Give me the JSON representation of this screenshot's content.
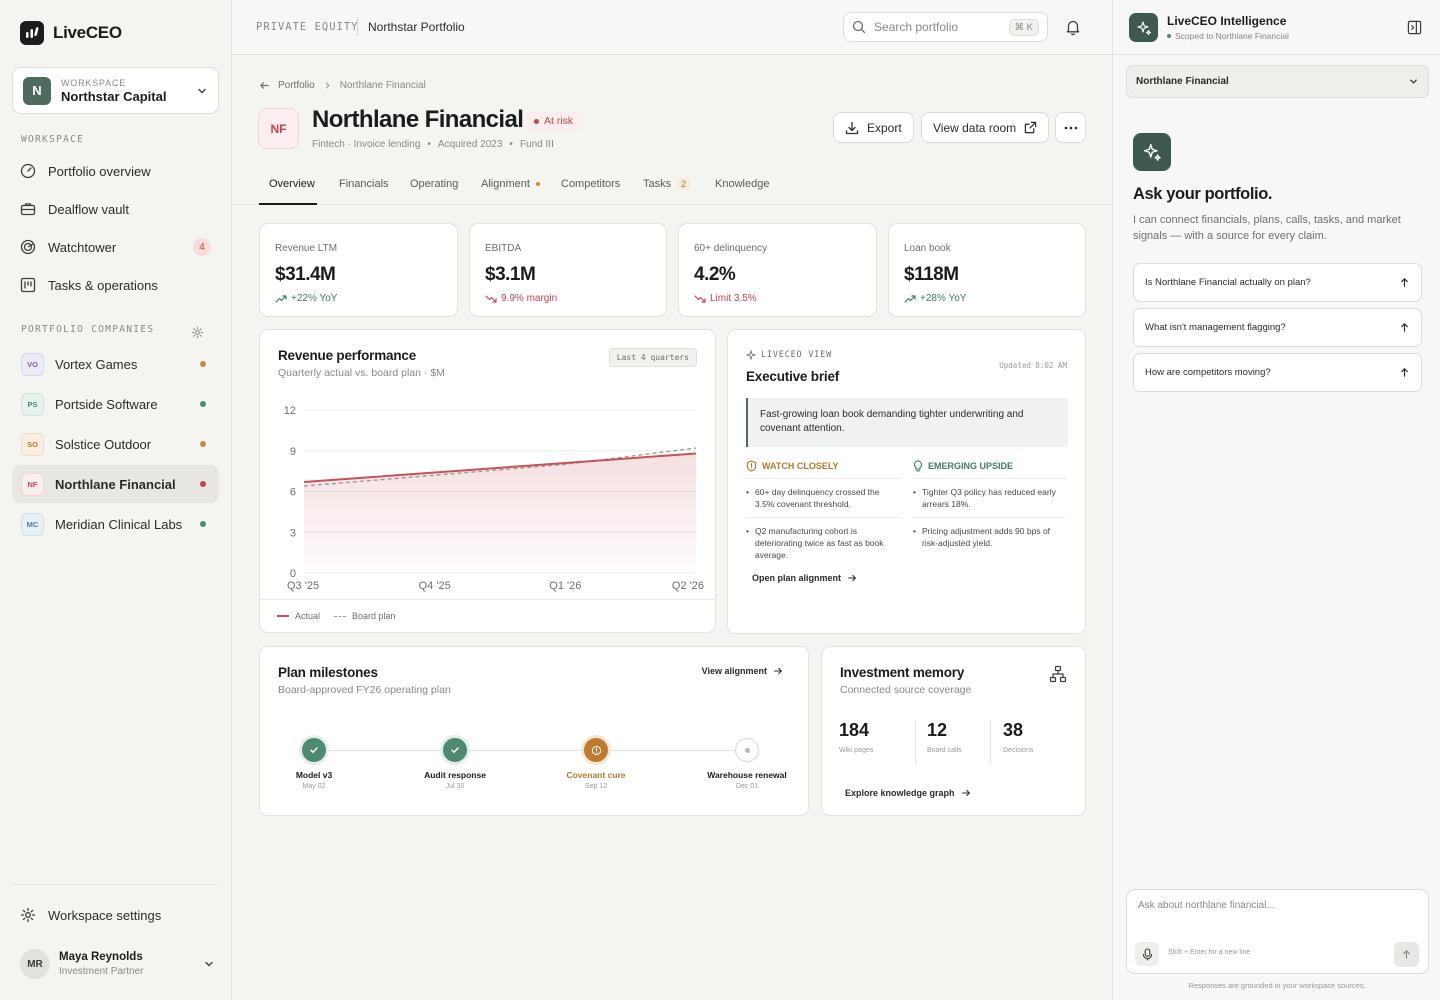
{
  "brand": {
    "name": "LiveCEO"
  },
  "workspace": {
    "label": "WORKSPACE",
    "name": "Northstar Capital",
    "initial": "N"
  },
  "nav": {
    "section_label": "WORKSPACE",
    "items": [
      {
        "label": "Portfolio overview",
        "icon": "gauge-icon"
      },
      {
        "label": "Dealflow vault",
        "icon": "briefcase-icon"
      },
      {
        "label": "Watchtower",
        "icon": "radar-icon",
        "badge": "4"
      },
      {
        "label": "Tasks & operations",
        "icon": "kanban-icon"
      }
    ]
  },
  "companies": {
    "section_label": "PORTFOLIO COMPANIES",
    "items": [
      {
        "initials": "VO",
        "name": "Vortex Games",
        "status_color": "#c98a3c"
      },
      {
        "initials": "PS",
        "name": "Portside Software",
        "status_color": "#4a8a6e"
      },
      {
        "initials": "SO",
        "name": "Solstice Outdoor",
        "status_color": "#c98a3c"
      },
      {
        "initials": "NF",
        "name": "Northlane Financial",
        "status_color": "#c0484f"
      },
      {
        "initials": "MC",
        "name": "Meridian Clinical Labs",
        "status_color": "#4a8a6e"
      }
    ]
  },
  "settings": {
    "label": "Workspace settings"
  },
  "user": {
    "initials": "MR",
    "name": "Maya Reynolds",
    "role": "Investment Partner"
  },
  "topbar": {
    "section": "PRIVATE EQUITY",
    "portfolio": "Northstar Portfolio",
    "search_placeholder": "Search portfolio",
    "shortcut": "⌘ K"
  },
  "company": {
    "breadcrumb_parent": "Portfolio",
    "breadcrumb_current": "Northlane Financial",
    "initials": "NF",
    "name": "Northlane Financial",
    "status": "At risk",
    "meta": [
      "Fintech · Invoice lending",
      "Acquired 2023",
      "Fund III"
    ],
    "export_label": "Export",
    "dataroom_label": "View data room"
  },
  "tabs": [
    {
      "label": "Overview"
    },
    {
      "label": "Financials"
    },
    {
      "label": "Operating"
    },
    {
      "label": "Alignment"
    },
    {
      "label": "Competitors"
    },
    {
      "label": "Tasks",
      "count": "2"
    },
    {
      "label": "Knowledge"
    }
  ],
  "kpis": [
    {
      "label": "Revenue LTM",
      "value": "$31.4M",
      "delta": "+22% YoY",
      "trend": "up"
    },
    {
      "label": "EBITDA",
      "value": "$3.1M",
      "delta": "9.9% margin",
      "trend": "down"
    },
    {
      "label": "60+ delinquency",
      "value": "4.2%",
      "delta": "Limit 3.5%",
      "trend": "down"
    },
    {
      "label": "Loan book",
      "value": "$118M",
      "delta": "+28% YoY",
      "trend": "up"
    }
  ],
  "revenue": {
    "title": "Revenue performance",
    "subtitle": "Quarterly actual vs. board plan · $M",
    "range": "Last 4 quarters",
    "legend_actual": "Actual",
    "legend_plan": "Board plan"
  },
  "chart_data": {
    "type": "area",
    "categories": [
      "Q3 '25",
      "Q4 '25",
      "Q1 '26",
      "Q2 '26"
    ],
    "series": [
      {
        "name": "Actual",
        "values": [
          6.7,
          7.4,
          8.1,
          8.8
        ]
      },
      {
        "name": "Board plan",
        "values": [
          6.4,
          7.2,
          8.0,
          9.2
        ]
      }
    ],
    "yticks": [
      0,
      3,
      6,
      9,
      12
    ],
    "ylim": [
      0,
      12
    ],
    "grid": true,
    "colors": {
      "actual": "#c9525a",
      "plan": "#9c9b96"
    }
  },
  "brief": {
    "kicker": "LIVECEO VIEW",
    "title": "Executive brief",
    "updated": "Updated 8:02 AM",
    "quote": "Fast-growing loan book demanding tighter underwriting and covenant attention.",
    "watch_label": "WATCH CLOSELY",
    "watch_items": [
      "60+ day delinquency crossed the 3.5% covenant threshold.",
      "Q2 manufacturing cohort is deteriorating twice as fast as book average."
    ],
    "upside_label": "EMERGING UPSIDE",
    "upside_items": [
      "Tighter Q3 policy has reduced early arrears 18%.",
      "Pricing adjustment adds 90 bps of risk-adjusted yield."
    ],
    "link": "Open plan alignment"
  },
  "milestones": {
    "title": "Plan milestones",
    "subtitle": "Board-approved FY26 operating plan",
    "link": "View alignment",
    "items": [
      {
        "name": "Model v3",
        "date": "May 02",
        "state": "done"
      },
      {
        "name": "Audit response",
        "date": "Jul 30",
        "state": "done"
      },
      {
        "name": "Covenant cure",
        "date": "Sep 12",
        "state": "warning"
      },
      {
        "name": "Warehouse renewal",
        "date": "Dec 01",
        "state": "pending"
      }
    ]
  },
  "memory": {
    "title": "Investment memory",
    "subtitle": "Connected source coverage",
    "stats": [
      {
        "value": "184",
        "label": "Wiki pages"
      },
      {
        "value": "12",
        "label": "Board calls"
      },
      {
        "value": "38",
        "label": "Decisions"
      }
    ],
    "link": "Explore knowledge graph"
  },
  "assistant": {
    "title": "LiveCEO Intelligence",
    "scope": "Scoped to Northlane Financial",
    "selected_company": "Northlane Financial",
    "heading": "Ask your portfolio.",
    "description": "I can connect financials, plans, calls, tasks, and market signals — with a source for every claim.",
    "questions": [
      "Is Northlane Financial actually on plan?",
      "What isn't management flagging?",
      "How are competitors moving?"
    ],
    "input_placeholder": "Ask about northlane financial...",
    "input_hint": "Shift + Enter for a new line",
    "footer": "Responses are grounded in your workspace sources."
  }
}
